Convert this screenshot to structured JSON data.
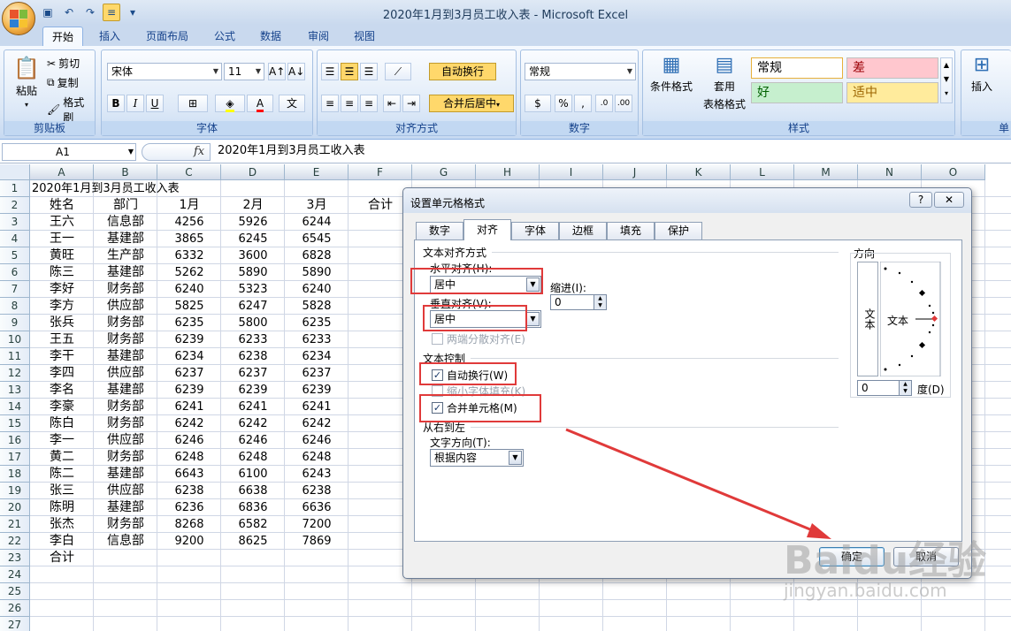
{
  "window": {
    "title": "2020年1月到3月员工收入表 - Microsoft Excel"
  },
  "ribbon": {
    "tabs": [
      "开始",
      "插入",
      "页面布局",
      "公式",
      "数据",
      "审阅",
      "视图"
    ],
    "active_tab": "开始",
    "clipboard": {
      "paste": "粘贴",
      "cut": "剪切",
      "copy": "复制",
      "format_painter": "格式刷",
      "label": "剪贴板"
    },
    "font": {
      "name": "宋体",
      "size": "11",
      "label": "字体"
    },
    "alignment": {
      "wrap_text": "自动换行",
      "merge_center": "合并后居中",
      "label": "对齐方式"
    },
    "number": {
      "format": "常规",
      "label": "数字"
    },
    "styles": {
      "conditional": "条件格式",
      "table_format_line1": "套用",
      "table_format_line2": "表格格式",
      "normal": "常规",
      "bad": "差",
      "good": "好",
      "neutral": "适中",
      "label": "样式"
    },
    "cells": {
      "insert": "插入",
      "label": "单"
    }
  },
  "formula_bar": {
    "name_box": "A1",
    "fx": "fx",
    "content": "2020年1月到3月员工收入表"
  },
  "sheet": {
    "columns": [
      "A",
      "B",
      "C",
      "D",
      "E",
      "F",
      "G",
      "H",
      "I",
      "J",
      "K",
      "L",
      "M",
      "N",
      "O"
    ],
    "row_numbers": [
      "1",
      "2",
      "3",
      "4",
      "5",
      "6",
      "7",
      "8",
      "9",
      "10",
      "11",
      "12",
      "13",
      "14",
      "15",
      "16",
      "17",
      "18",
      "19",
      "20",
      "21",
      "22",
      "23",
      "24",
      "25",
      "26",
      "27"
    ],
    "title": "2020年1月到3月员工收入表",
    "headers": [
      "姓名",
      "部门",
      "1月",
      "2月",
      "3月",
      "合计"
    ],
    "rows": [
      [
        "王六",
        "信息部",
        "4256",
        "5926",
        "6244"
      ],
      [
        "王一",
        "基建部",
        "3865",
        "6245",
        "6545"
      ],
      [
        "黄旺",
        "生产部",
        "6332",
        "3600",
        "6828"
      ],
      [
        "陈三",
        "基建部",
        "5262",
        "5890",
        "5890"
      ],
      [
        "李好",
        "财务部",
        "6240",
        "5323",
        "6240"
      ],
      [
        "李方",
        "供应部",
        "5825",
        "6247",
        "5828"
      ],
      [
        "张兵",
        "财务部",
        "6235",
        "5800",
        "6235"
      ],
      [
        "王五",
        "财务部",
        "6239",
        "6233",
        "6233"
      ],
      [
        "李干",
        "基建部",
        "6234",
        "6238",
        "6234"
      ],
      [
        "李四",
        "供应部",
        "6237",
        "6237",
        "6237"
      ],
      [
        "李名",
        "基建部",
        "6239",
        "6239",
        "6239"
      ],
      [
        "李豪",
        "财务部",
        "6241",
        "6241",
        "6241"
      ],
      [
        "陈白",
        "财务部",
        "6242",
        "6242",
        "6242"
      ],
      [
        "李一",
        "供应部",
        "6246",
        "6246",
        "6246"
      ],
      [
        "黄二",
        "财务部",
        "6248",
        "6248",
        "6248"
      ],
      [
        "陈二",
        "基建部",
        "6643",
        "6100",
        "6243"
      ],
      [
        "张三",
        "供应部",
        "6238",
        "6638",
        "6238"
      ],
      [
        "陈明",
        "基建部",
        "6236",
        "6836",
        "6636"
      ],
      [
        "张杰",
        "财务部",
        "8268",
        "6582",
        "7200"
      ],
      [
        "李白",
        "信息部",
        "9200",
        "8625",
        "7869"
      ]
    ],
    "total_label": "合计"
  },
  "dialog": {
    "title": "设置单元格格式",
    "help": "?",
    "close": "✕",
    "tabs": [
      "数字",
      "对齐",
      "字体",
      "边框",
      "填充",
      "保护"
    ],
    "active_tab": "对齐",
    "text_alignment_section": "文本对齐方式",
    "horizontal_label": "水平对齐(H):",
    "horizontal_value": "居中",
    "indent_label": "缩进(I):",
    "indent_value": "0",
    "vertical_label": "垂直对齐(V):",
    "vertical_value": "居中",
    "justify_distributed": "两端分散对齐(E)",
    "text_control_section": "文本控制",
    "wrap_text": "自动换行(W)",
    "shrink_to_fit": "缩小字体填充(K)",
    "merge_cells": "合并单元格(M)",
    "rtl_section": "从右到左",
    "text_direction_label": "文字方向(T):",
    "text_direction_value": "根据内容",
    "orientation_section": "方向",
    "orientation_vertical_text": "文本",
    "orientation_text": "文本",
    "degree_value": "0",
    "degree_label": "度(D)",
    "ok": "确定",
    "cancel": "取消"
  },
  "watermark": {
    "brand": "Baidu经验",
    "url": "jingyan.baidu.com"
  },
  "colors": {
    "highlight_red": "#e03a3a",
    "ribbon_blue": "#15428b",
    "style_bad_bg": "#ffc7ce",
    "style_good_bg": "#c6efce",
    "style_neutral_bg": "#ffeb9c"
  }
}
